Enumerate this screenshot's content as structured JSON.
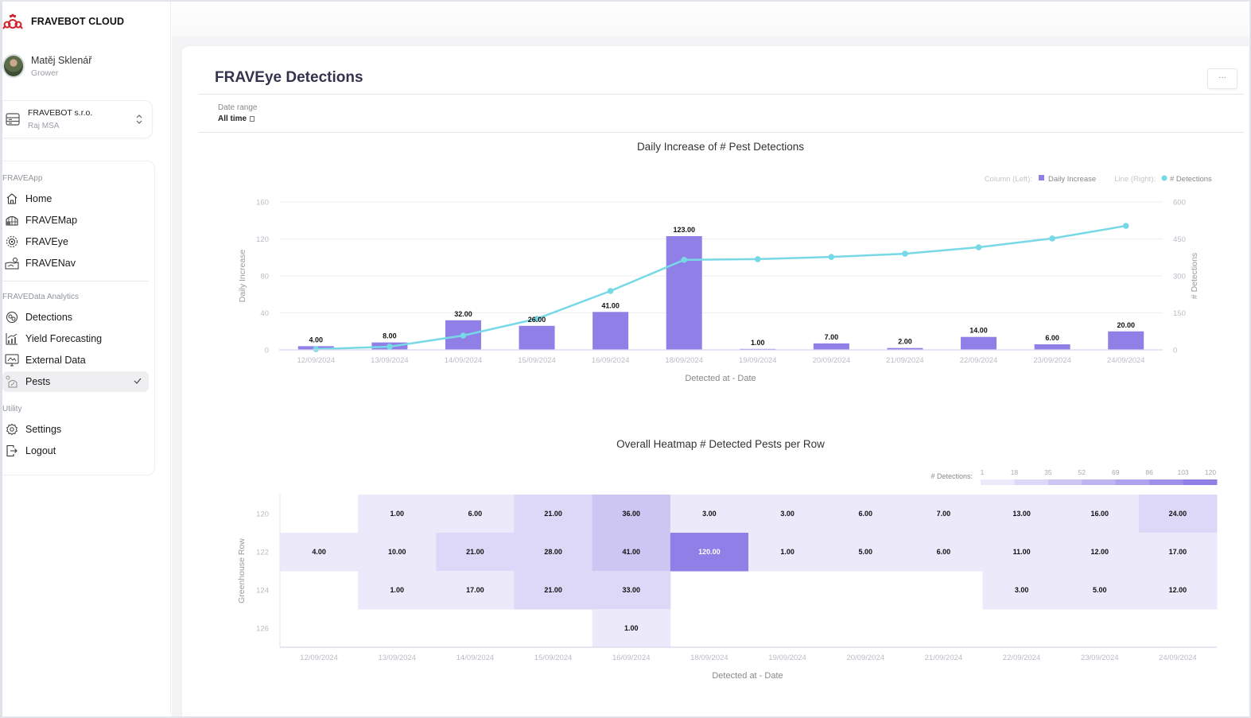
{
  "app": {
    "brand": "FRAVEBOT CLOUD",
    "user": {
      "name": "Matěj Sklenář",
      "role": "Grower"
    },
    "org": {
      "name": "FRAVEBOT s.r.o.",
      "sub": "Raj MSA"
    }
  },
  "sidebar": {
    "sections": [
      {
        "label": "FRAVEApp",
        "items": [
          {
            "label": "Home",
            "icon": "home-icon"
          },
          {
            "label": "FRAVEMap",
            "icon": "greenhouse-map-icon"
          },
          {
            "label": "FRAVEye",
            "icon": "eye-scan-icon"
          },
          {
            "label": "FRAVENav",
            "icon": "navigation-map-icon"
          }
        ]
      },
      {
        "label": "FRAVEData Analytics",
        "items": [
          {
            "label": "Detections",
            "icon": "detections-icon"
          },
          {
            "label": "Yield Forecasting",
            "icon": "forecast-chart-icon"
          },
          {
            "label": "External Data",
            "icon": "external-data-icon"
          },
          {
            "label": "Pests",
            "icon": "pests-icon",
            "active": true
          }
        ]
      },
      {
        "label": "Utility",
        "items": [
          {
            "label": "Settings",
            "icon": "gear-icon"
          },
          {
            "label": "Logout",
            "icon": "logout-icon"
          }
        ]
      }
    ]
  },
  "page": {
    "title": "FRAVEye Detections",
    "more_label": "···",
    "date_range": {
      "label": "Date range",
      "value": "All time"
    }
  },
  "colors": {
    "bar": "#8f7fe6",
    "line": "#77d9e6",
    "heat_min": "#eceafa",
    "heat_max": "#8f7fe6"
  },
  "chart_data": [
    {
      "type": "bar+line",
      "title": "Daily Increase of # Pest Detections",
      "legend": {
        "position": "top-right",
        "column_prefix": "Column (Left):",
        "column_name": "Daily Increase",
        "line_prefix": "Line (Right):",
        "line_name": "# Detections"
      },
      "xlabel": "Detected at - Date",
      "ylabel_left": "Daily Increase",
      "ylabel_right": "# Detections",
      "ylim_left": [
        0,
        160
      ],
      "yticks_left": [
        0,
        40,
        80,
        120,
        160
      ],
      "ylim_right": [
        0,
        600
      ],
      "yticks_right": [
        0,
        150,
        300,
        450,
        600
      ],
      "categories": [
        "12/09/2024",
        "13/09/2024",
        "14/09/2024",
        "15/09/2024",
        "16/09/2024",
        "18/09/2024",
        "19/09/2024",
        "20/09/2024",
        "21/09/2024",
        "22/09/2024",
        "23/09/2024",
        "24/09/2024"
      ],
      "series": [
        {
          "name": "Daily Increase",
          "axis": "left",
          "type": "bar",
          "values": [
            4,
            8,
            32,
            26,
            41,
            123,
            1,
            7,
            2,
            14,
            6,
            20
          ],
          "labels": [
            "4.00",
            "8.00",
            "32.00",
            "26.00",
            "41.00",
            "123.00",
            "1.00",
            "7.00",
            "2.00",
            "14.00",
            "6.00",
            "20.00"
          ]
        },
        {
          "name": "# Detections",
          "axis": "right",
          "type": "line",
          "values": [
            3,
            13,
            58,
            126,
            239,
            365,
            368,
            377,
            390,
            416,
            452,
            503
          ]
        }
      ],
      "grid": true
    },
    {
      "type": "heatmap",
      "title": "Overall Heatmap # Detected Pests per Row",
      "xlabel": "Detected at - Date",
      "ylabel": "Greenhouse Row",
      "x": [
        "12/09/2024",
        "13/09/2024",
        "14/09/2024",
        "15/09/2024",
        "16/09/2024",
        "18/09/2024",
        "19/09/2024",
        "20/09/2024",
        "21/09/2024",
        "22/09/2024",
        "23/09/2024",
        "24/09/2024"
      ],
      "y": [
        "120",
        "122",
        "124",
        "126"
      ],
      "values": [
        [
          null,
          1,
          6,
          21,
          36,
          3,
          3,
          6,
          7,
          13,
          16,
          24
        ],
        [
          4,
          10,
          21,
          28,
          41,
          120,
          1,
          5,
          6,
          11,
          12,
          17
        ],
        [
          null,
          1,
          17,
          21,
          33,
          null,
          null,
          null,
          null,
          3,
          5,
          12
        ],
        [
          null,
          null,
          null,
          null,
          1,
          null,
          null,
          null,
          null,
          null,
          null,
          null
        ]
      ],
      "legend": {
        "label": "# Detections:",
        "stops": [
          "1",
          "18",
          "35",
          "52",
          "69",
          "86",
          "103",
          "120"
        ],
        "position": "top-right"
      },
      "range": [
        1,
        120
      ]
    }
  ]
}
